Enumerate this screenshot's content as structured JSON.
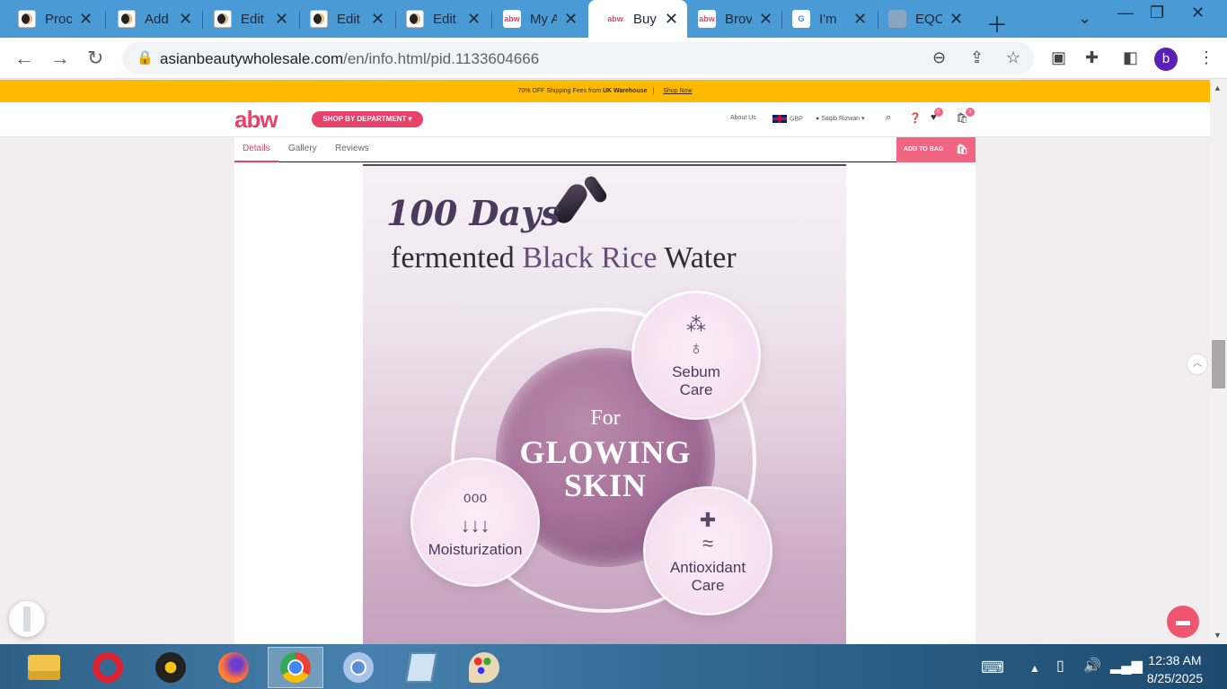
{
  "browser": {
    "tabs": [
      {
        "title": "Proc",
        "favicon": "dark-logo-icon"
      },
      {
        "title": "Add",
        "favicon": "dark-logo-icon"
      },
      {
        "title": "Edit",
        "favicon": "dark-logo-icon"
      },
      {
        "title": "Edit",
        "favicon": "dark-logo-icon"
      },
      {
        "title": "Edit",
        "favicon": "dark-logo-icon"
      },
      {
        "title": "My A",
        "favicon": "abw-icon"
      },
      {
        "title": "Buy",
        "favicon": "abw-icon",
        "active": true
      },
      {
        "title": "Brov",
        "favicon": "abw-icon"
      },
      {
        "title": "I'm",
        "favicon": "google-icon"
      },
      {
        "title": "EQC",
        "favicon": "globe-icon"
      }
    ],
    "url_domain": "asianbeautywholesale.com",
    "url_path": "/en/info.html/pid.1133604666",
    "profile_initial": "b"
  },
  "site": {
    "promo_text": "70% OFF Shipping Fees from",
    "promo_bold": "UK Warehouse",
    "promo_link": "Shop Now",
    "logo": "abw",
    "shop_department": "SHOP BY DEPARTMENT ▾",
    "about": "About Us",
    "currency": "GBP",
    "user": "Saqib Rizwan",
    "wishlist_count": "0",
    "cart_count": "0",
    "tabs": [
      "Details",
      "Gallery",
      "Reviews"
    ],
    "add_to_bag": "ADD TO BAG"
  },
  "product_image": {
    "headline_days": "100 Days",
    "headline_prefix": "fermented",
    "headline_accent": "Black Rice",
    "headline_suffix": "Water",
    "center_for": "For",
    "center_line1": "GLOWING",
    "center_line2": "SKIN",
    "bubbles": [
      {
        "label1": "Sebum",
        "label2": "Care",
        "icon": "droplet-icon"
      },
      {
        "label1": "Moisturization",
        "label2": "",
        "icon": "water-drops-icon"
      },
      {
        "label1": "Antioxidant",
        "label2": "Care",
        "icon": "cross-waves-icon"
      }
    ]
  },
  "taskbar": {
    "time": "12:38 AM",
    "date": "8/25/2025"
  }
}
